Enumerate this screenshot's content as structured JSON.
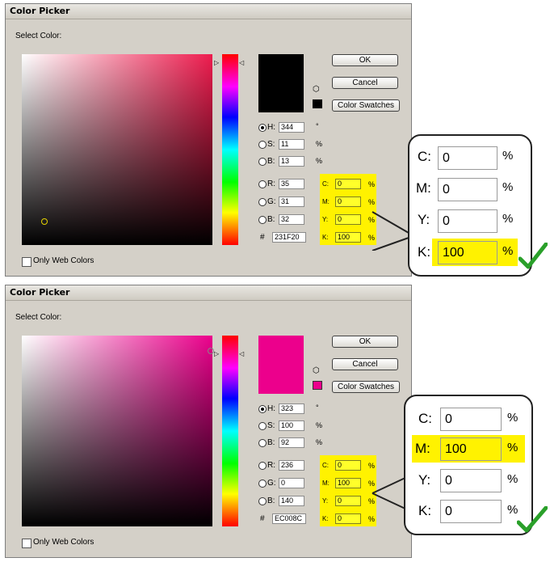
{
  "colors": {
    "picked1": "#000000",
    "picked2": "#ec008c",
    "highlight": "#fff200",
    "check": "#2aa02a"
  },
  "icons": {
    "check": "check-icon",
    "gamut": "cube-icon"
  },
  "dialog1": {
    "title": "Color Picker",
    "select_label": "Select Color:",
    "buttons": {
      "ok": "OK",
      "cancel": "Cancel",
      "swatches": "Color Swatches"
    },
    "hsb": {
      "h_label": "H:",
      "h": "344",
      "h_unit": "°",
      "s_label": "S:",
      "s": "11",
      "s_unit": "%",
      "b_label": "B:",
      "b": "13",
      "b_unit": "%"
    },
    "rgb": {
      "r_label": "R:",
      "r": "35",
      "g_label": "G:",
      "g": "31",
      "b_label": "B:",
      "b": "32"
    },
    "hex": {
      "label": "#",
      "value": "231F20"
    },
    "cmyk": {
      "c_label": "C:",
      "c": "0",
      "m_label": "M:",
      "m": "0",
      "y_label": "Y:",
      "y": "0",
      "k_label": "K:",
      "k": "100",
      "unit": "%"
    },
    "web_only": "Only Web Colors"
  },
  "dialog2": {
    "title": "Color Picker",
    "select_label": "Select Color:",
    "buttons": {
      "ok": "OK",
      "cancel": "Cancel",
      "swatches": "Color Swatches"
    },
    "hsb": {
      "h_label": "H:",
      "h": "323",
      "h_unit": "°",
      "s_label": "S:",
      "s": "100",
      "s_unit": "%",
      "b_label": "B:",
      "b": "92",
      "b_unit": "%"
    },
    "rgb": {
      "r_label": "R:",
      "r": "236",
      "g_label": "G:",
      "g": "0",
      "b_label": "B:",
      "b": "140"
    },
    "hex": {
      "label": "#",
      "value": "EC008C"
    },
    "cmyk": {
      "c_label": "C:",
      "c": "0",
      "m_label": "M:",
      "m": "100",
      "y_label": "Y:",
      "y": "0",
      "k_label": "K:",
      "k": "0",
      "unit": "%"
    },
    "web_only": "Only Web Colors"
  },
  "zoom1": {
    "c_label": "C:",
    "c": "0",
    "m_label": "M:",
    "m": "0",
    "y_label": "Y:",
    "y": "0",
    "k_label": "K:",
    "k": "100",
    "unit": "%"
  },
  "zoom2": {
    "c_label": "C:",
    "c": "0",
    "m_label": "M:",
    "m": "100",
    "y_label": "Y:",
    "y": "0",
    "k_label": "K:",
    "k": "0",
    "unit": "%"
  }
}
